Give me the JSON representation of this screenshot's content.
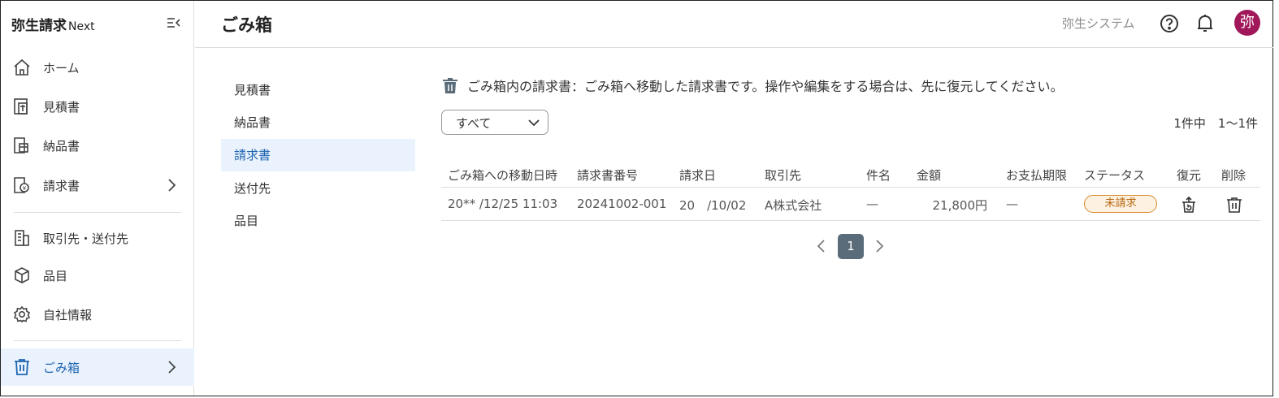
{
  "app": {
    "brand_main": "弥生請求",
    "brand_sub": "Next"
  },
  "sidebar": {
    "items": [
      {
        "label": "ホーム",
        "icon": "home-icon"
      },
      {
        "label": "見積書",
        "icon": "estimate-icon"
      },
      {
        "label": "納品書",
        "icon": "delivery-icon"
      },
      {
        "label": "請求書",
        "icon": "invoice-icon"
      },
      {
        "label": "取引先・送付先",
        "icon": "building-icon"
      },
      {
        "label": "品目",
        "icon": "box-icon"
      },
      {
        "label": "自社情報",
        "icon": "gear-icon"
      },
      {
        "label": "ごみ箱",
        "icon": "trash-icon",
        "active": true
      }
    ]
  },
  "header": {
    "title": "ごみ箱",
    "company": "弥生システム",
    "avatar": "弥",
    "avatar_color": "#a0185a"
  },
  "subnav": {
    "items": [
      {
        "label": "見積書"
      },
      {
        "label": "納品書"
      },
      {
        "label": "請求書",
        "active": true
      },
      {
        "label": "送付先"
      },
      {
        "label": "品目"
      }
    ]
  },
  "main": {
    "notice": "ごみ箱内の請求書：ごみ箱へ移動した請求書です。操作や編集をする場合は、先に復元してください。",
    "filter": {
      "selected": "すべて"
    },
    "count": "1件中　1〜1件",
    "table": {
      "headers": [
        "ごみ箱への移動日時",
        "請求書番号",
        "請求日",
        "取引先",
        "件名",
        "金額",
        "お支払期限",
        "ステータス",
        "復元",
        "削除"
      ],
      "rows": [
        {
          "moved_at": "20** /12/25 11:03",
          "number": "20241002-001",
          "date": "20　/10/02",
          "client": "A株式会社",
          "subject": "—",
          "amount": "21,800円",
          "due": "—",
          "status": "未請求"
        }
      ]
    },
    "pagination": {
      "current": "1"
    }
  },
  "colors": {
    "accent": "#1e63b0",
    "active_bg": "#eaf3fd",
    "status_orange": "#d98a2b"
  }
}
